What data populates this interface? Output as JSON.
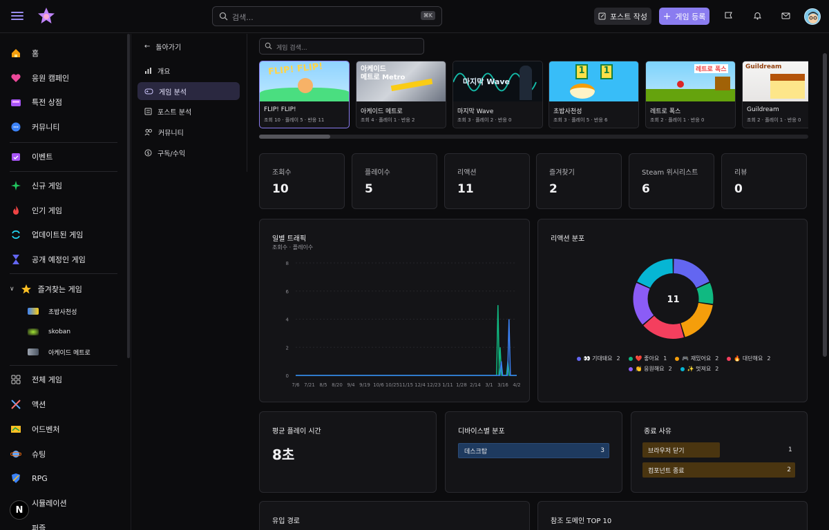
{
  "header": {
    "search_placeholder": "검색...",
    "search_shortcut": "⌘K",
    "post_button": "포스트 작성",
    "game_button": "게임 등록"
  },
  "sidebar": {
    "items": [
      {
        "label": "홈",
        "icon": "home-icon"
      },
      {
        "label": "응원 캠페인",
        "icon": "heart-icon"
      },
      {
        "label": "특전 상점",
        "icon": "store-icon"
      },
      {
        "label": "커뮤니티",
        "icon": "chat-icon"
      },
      {
        "label": "이벤트",
        "icon": "calendar-icon"
      },
      {
        "label": "신규 게임",
        "icon": "sparkle-icon"
      },
      {
        "label": "인기 게임",
        "icon": "fire-icon"
      },
      {
        "label": "업데이트된 게임",
        "icon": "refresh-icon"
      },
      {
        "label": "공개 예정인 게임",
        "icon": "hourglass-icon"
      }
    ],
    "favorites_label": "즐겨찾는 게임",
    "favorites": [
      "초밥사천성",
      "skoban",
      "아케이드 메트로"
    ],
    "genres": [
      {
        "label": "전체 게임",
        "icon": "grid-icon"
      },
      {
        "label": "액션",
        "icon": "swords-icon"
      },
      {
        "label": "어드벤처",
        "icon": "map-icon"
      },
      {
        "label": "슈팅",
        "icon": "planet-icon"
      },
      {
        "label": "RPG",
        "icon": "shield-icon"
      },
      {
        "label": "시뮬레이션",
        "icon": "tools-icon"
      },
      {
        "label": "퍼즐",
        "icon": "puzzle-icon"
      }
    ]
  },
  "subnav": {
    "back": "돌아가기",
    "items": [
      "개요",
      "게임 분석",
      "포스트 분석",
      "커뮤니티",
      "구독/수익"
    ],
    "active_index": 1
  },
  "game_search_placeholder": "게임 검색...",
  "games": [
    {
      "name": "FLIP! FLIP!",
      "stats": "조회 10 · 플레이 5 · 반응 11"
    },
    {
      "name": "아케이드 메트로",
      "stats": "조회 4 · 플레이 1 · 반응 2"
    },
    {
      "name": "마지막 Wave",
      "stats": "조회 3 · 플레이 2 · 반응 0"
    },
    {
      "name": "초밥사천성",
      "stats": "조회 3 · 플레이 5 · 반응 6"
    },
    {
      "name": "레트로 폭스",
      "stats": "조회 2 · 플레이 1 · 반응 0"
    },
    {
      "name": "Guildream",
      "stats": "조회 2 · 플레이 1 · 반응 0"
    }
  ],
  "stats": [
    {
      "label": "조회수",
      "value": "10"
    },
    {
      "label": "플레이수",
      "value": "5"
    },
    {
      "label": "리액션",
      "value": "11"
    },
    {
      "label": "즐겨찾기",
      "value": "2"
    },
    {
      "label": "Steam 위시리스트",
      "value": "6"
    },
    {
      "label": "리뷰",
      "value": "0"
    }
  ],
  "traffic": {
    "title": "일별 트래픽",
    "subtitle": "조회수 · 플레이수"
  },
  "reaction": {
    "title": "리액션 분포",
    "total": "11",
    "legend": [
      {
        "label": "👀 기대돼요",
        "count": "2",
        "color": "#6366f1"
      },
      {
        "label": "❤️ 좋아요",
        "count": "1",
        "color": "#10b981"
      },
      {
        "label": "🎮 재밌어요",
        "count": "2",
        "color": "#f59e0b"
      },
      {
        "label": "🔥 대단해요",
        "count": "2",
        "color": "#f43f5e"
      },
      {
        "label": "👏 응원해요",
        "count": "2",
        "color": "#8b5cf6"
      },
      {
        "label": "✨ 멋져요",
        "count": "2",
        "color": "#06b6d4"
      }
    ]
  },
  "avg_play": {
    "title": "평균 플레이 시간",
    "value": "8초"
  },
  "devices": {
    "title": "디바이스별 분포",
    "rows": [
      {
        "label": "데스크탑",
        "value": "3"
      }
    ]
  },
  "exit": {
    "title": "종료 사유",
    "rows": [
      {
        "label": "브라우저 닫기",
        "value": "1"
      },
      {
        "label": "컴포넌트 종료",
        "value": "2"
      }
    ]
  },
  "inflow": {
    "title": "유입 경로"
  },
  "referrer": {
    "title": "참조 도메인 TOP 10"
  },
  "chart_data": [
    {
      "type": "line",
      "title": "일별 트래픽",
      "subtitle": "조회수 · 플레이수",
      "x": [
        "7/6",
        "7/21",
        "8/5",
        "8/20",
        "9/4",
        "9/19",
        "10/6",
        "10/25",
        "11/15",
        "12/4",
        "12/23",
        "1/11",
        "1/28",
        "2/14",
        "3/1",
        "3/16",
        "4/2"
      ],
      "yticks": [
        0,
        2,
        4,
        6,
        8
      ],
      "ylim": [
        0,
        8
      ],
      "grid": true,
      "series": [
        {
          "color": "#10b981",
          "spikes": [
            [
              0.915,
              5
            ],
            [
              0.925,
              2
            ],
            [
              0.96,
              1
            ]
          ]
        },
        {
          "color": "#3b82f6",
          "spikes": [
            [
              0.93,
              1
            ],
            [
              0.965,
              4
            ]
          ]
        }
      ]
    },
    {
      "type": "pie",
      "title": "리액션 분포",
      "labels": [
        "👀 기대돼요",
        "❤️ 좋아요",
        "🎮 재밌어요",
        "🔥 대단해요",
        "👏 응원해요",
        "✨ 멋져요"
      ],
      "values": [
        2,
        1,
        2,
        2,
        2,
        2
      ],
      "colors": [
        "#6366f1",
        "#10b981",
        "#f59e0b",
        "#f43f5e",
        "#8b5cf6",
        "#06b6d4"
      ]
    }
  ]
}
